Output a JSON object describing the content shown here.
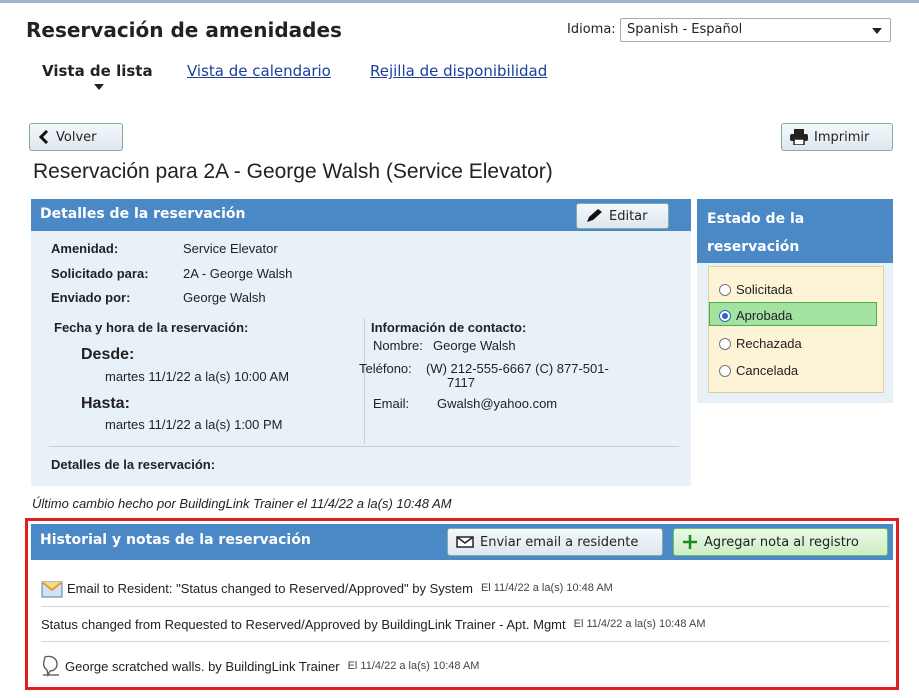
{
  "header": {
    "title": "Reservación de amenidades",
    "language_label": "Idioma:",
    "language_value": "Spanish - Español"
  },
  "tabs": [
    {
      "label": "Vista de lista",
      "active": true
    },
    {
      "label": "Vista de calendario",
      "active": false
    },
    {
      "label": "Rejilla de disponibilidad",
      "active": false
    }
  ],
  "buttons": {
    "back": "Volver",
    "print": "Imprimir",
    "edit": "Editar",
    "email_resident": "Enviar email a residente",
    "add_note": "Agregar nota al registro"
  },
  "page_title": "Reservación para 2A - George Walsh (Service Elevator)",
  "details": {
    "heading": "Detalles de la reservación",
    "amenity_label": "Amenidad:",
    "amenity_value": "Service Elevator",
    "requested_for_label": "Solicitado para:",
    "requested_for_value": "2A - George Walsh",
    "sent_by_label": "Enviado por:",
    "sent_by_value": "George Walsh",
    "datetime_label": "Fecha y hora de la reservación:",
    "from_label": "Desde:",
    "from_value": "martes 11/1/22 a la(s) 10:00 AM",
    "to_label": "Hasta:",
    "to_value": "martes 11/1/22 a la(s) 1:00 PM",
    "contact_label": "Información de contacto:",
    "name_label": "Nombre:",
    "name_value": "George Walsh",
    "phone_label": "Teléfono:",
    "phone_value_line1": "(W) 212-555-6667 (C) 877-501-",
    "phone_value_line2": "7117",
    "email_label": "Email:",
    "email_value": "Gwalsh@yahoo.com",
    "footer_label": "Detalles de la reservación:"
  },
  "status": {
    "heading_line1": "Estado de la",
    "heading_line2": "reservación",
    "options": [
      {
        "label": "Solicitada",
        "selected": false
      },
      {
        "label": "Aprobada",
        "selected": true
      },
      {
        "label": "Rechazada",
        "selected": false
      },
      {
        "label": "Cancelada",
        "selected": false
      }
    ],
    "highlight_color": "#a4e2a0"
  },
  "last_change": "Último cambio hecho por BuildingLink Trainer el 11/4/22 a la(s) 10:48 AM",
  "history": {
    "heading": "Historial y notas de la reservación",
    "outline_color": "#e21f1f",
    "entries": [
      {
        "icon": "envelope-icon",
        "text": "Email to Resident: \"Status changed to Reserved/Approved\" by System",
        "time": "El 11/4/22 a la(s) 10:48 AM"
      },
      {
        "icon": "",
        "text": "Status changed from Requested to Reserved/Approved by BuildingLink Trainer - Apt. Mgmt",
        "time": "El 11/4/22 a la(s) 10:48 AM"
      },
      {
        "icon": "note-icon",
        "text": "George scratched walls. by BuildingLink Trainer",
        "time": "El 11/4/22 a la(s) 10:48 AM"
      }
    ]
  }
}
